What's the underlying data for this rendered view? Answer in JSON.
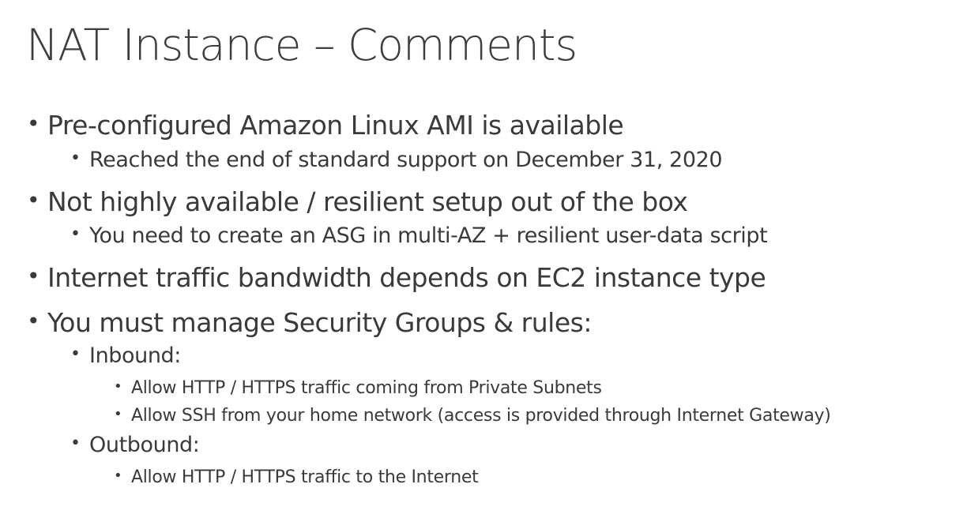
{
  "title": "NAT Instance – Comments",
  "bullet_glyph": "•",
  "items": [
    {
      "text": "Pre-configured Amazon Linux AMI is available"
    },
    {
      "text": "Reached the end of standard support on December 31, 2020"
    },
    {
      "text": "Not highly available / resilient setup out of the box"
    },
    {
      "text": "You need to create an ASG in multi-AZ + resilient user-data script"
    },
    {
      "text": "Internet traffic bandwidth depends on EC2 instance type"
    },
    {
      "text": "You must manage Security Groups & rules:"
    },
    {
      "text": "Inbound:"
    },
    {
      "text": "Allow HTTP / HTTPS traffic coming from Private Subnets"
    },
    {
      "text": "Allow SSH from your home network (access is provided through Internet Gateway)"
    },
    {
      "text": "Outbound:"
    },
    {
      "text": "Allow HTTP / HTTPS traffic to the Internet"
    }
  ]
}
